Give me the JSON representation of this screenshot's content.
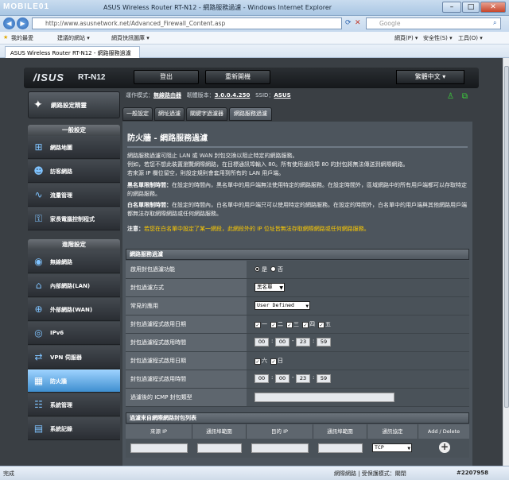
{
  "window": {
    "watermark": "MOBILE01",
    "title": "ASUS Wireless Router RT-N12 - 網路服務過濾 - Windows Internet Explorer"
  },
  "addressbar": {
    "url": "http://www.asusnetwork.net/Advanced_Firewall_Content.asp",
    "search_placeholder": "Google"
  },
  "favorites": {
    "items": [
      "我的最愛",
      "建議的網站 ▾",
      "網頁快訊圖庫 ▾"
    ],
    "right_items": [
      "網頁(P) ▾",
      "安全性(S) ▾",
      "工具(O) ▾"
    ]
  },
  "ietab": {
    "label": "ASUS Wireless Router RT-N12 - 網路服務過濾"
  },
  "router": {
    "brand": "/ISUS",
    "model": "RT-N12",
    "logout": "登出",
    "reboot": "重新開機",
    "language": "繁體中文"
  },
  "status": {
    "mode_label": "運作模式：",
    "mode_value": "無線路由器",
    "fw_label": "韌體版本：",
    "fw_value": "3.0.0.4.250",
    "ssid_label": "SSID：",
    "ssid_value": "ASUS"
  },
  "sidebar": {
    "qis": "網路設定精靈",
    "general_header": "一般設定",
    "general": [
      {
        "label": "網路地圖",
        "icon": "network-map-icon"
      },
      {
        "label": "訪客網路",
        "icon": "guest-network-icon"
      },
      {
        "label": "流量管理",
        "icon": "traffic-manager-icon"
      },
      {
        "label": "家長電腦控制程式",
        "icon": "parental-control-icon"
      }
    ],
    "advanced_header": "進階設定",
    "advanced": [
      {
        "label": "無線網路",
        "icon": "wireless-icon"
      },
      {
        "label": "內部網路(LAN)",
        "icon": "lan-icon"
      },
      {
        "label": "外部網路(WAN)",
        "icon": "wan-icon"
      },
      {
        "label": "IPv6",
        "icon": "ipv6-icon"
      },
      {
        "label": "VPN 伺服器",
        "icon": "vpn-icon"
      },
      {
        "label": "防火牆",
        "icon": "firewall-icon"
      },
      {
        "label": "系統管理",
        "icon": "administration-icon"
      },
      {
        "label": "系統記錄",
        "icon": "system-log-icon"
      }
    ]
  },
  "tabs": [
    "一般設定",
    "網址過濾",
    "關鍵字過濾器",
    "網路服務過濾"
  ],
  "content": {
    "title": "防火牆 - 網路服務過濾",
    "p1": "網路服務過濾可阻止 LAN 或 WAN 封包交換以阻止特定的網路服務。",
    "p2": "例如，若您不想此裝置瀏覽網際網路，在目標通訊埠輸入 80。所有使用通訊埠 80 的封包將無法傳送到網際網路。",
    "p3": "若來源 IP 欄位留空，則設定規則會套用到所有的 LAN 用戶端。",
    "p4_label": "黑名單限制時間：",
    "p4": "在設定的時間內，黑名單中的用戶端無法使用特定的網路服務。在設定時間外，區域網路中的所有用戶端都可以存取特定的網路服務。",
    "p5_label": "白名單限制時間：",
    "p5": "在設定的時間內，白名單中的用戶端只可以使用特定的網路服務。在設定的時間外，白名單中的用戶端與其他網路用戶端都無法存取網際網路或任何網路服務。",
    "note_label": "注意：",
    "note": "若您在白名單中設定了某一網段，此網段外的 IP 位址皆無法存取網際網路或任何網路服務。"
  },
  "filter_table": {
    "header": "網路服務過濾",
    "rows": [
      {
        "label": "啟用封包過濾功能",
        "type": "radio",
        "options": [
          "是",
          "否"
        ],
        "selected": "否"
      },
      {
        "label": "封包過濾方式",
        "type": "select",
        "value": "黑名單"
      },
      {
        "label": "常見的應用",
        "type": "select",
        "value": "User Defined"
      },
      {
        "label": "封包過濾程式啟用日期",
        "type": "days",
        "days": [
          "一",
          "二",
          "三",
          "四",
          "五"
        ]
      },
      {
        "label": "封包過濾程式啟用時間",
        "type": "time",
        "values": [
          "00",
          "00",
          "23",
          "59"
        ]
      },
      {
        "label": "封包過濾程式啟用日期",
        "type": "days",
        "days": [
          "六",
          "日"
        ]
      },
      {
        "label": "封包過濾程式啟用時間",
        "type": "time",
        "values": [
          "00",
          "00",
          "23",
          "59"
        ]
      },
      {
        "label": "過濾後的 ICMP 封包類型",
        "type": "text",
        "value": ""
      }
    ]
  },
  "list_table": {
    "header": "過濾來自網際網路封包列表",
    "columns": [
      "來源 IP",
      "通訊埠範圍",
      "目的 IP",
      "通訊埠範圍",
      "通訊協定",
      "Add / Delete"
    ],
    "protocol_value": "TCP"
  },
  "iestatus": {
    "left": "完成",
    "zone": "網際網路 | 受保護模式：關閉",
    "badge": "#2207958"
  }
}
